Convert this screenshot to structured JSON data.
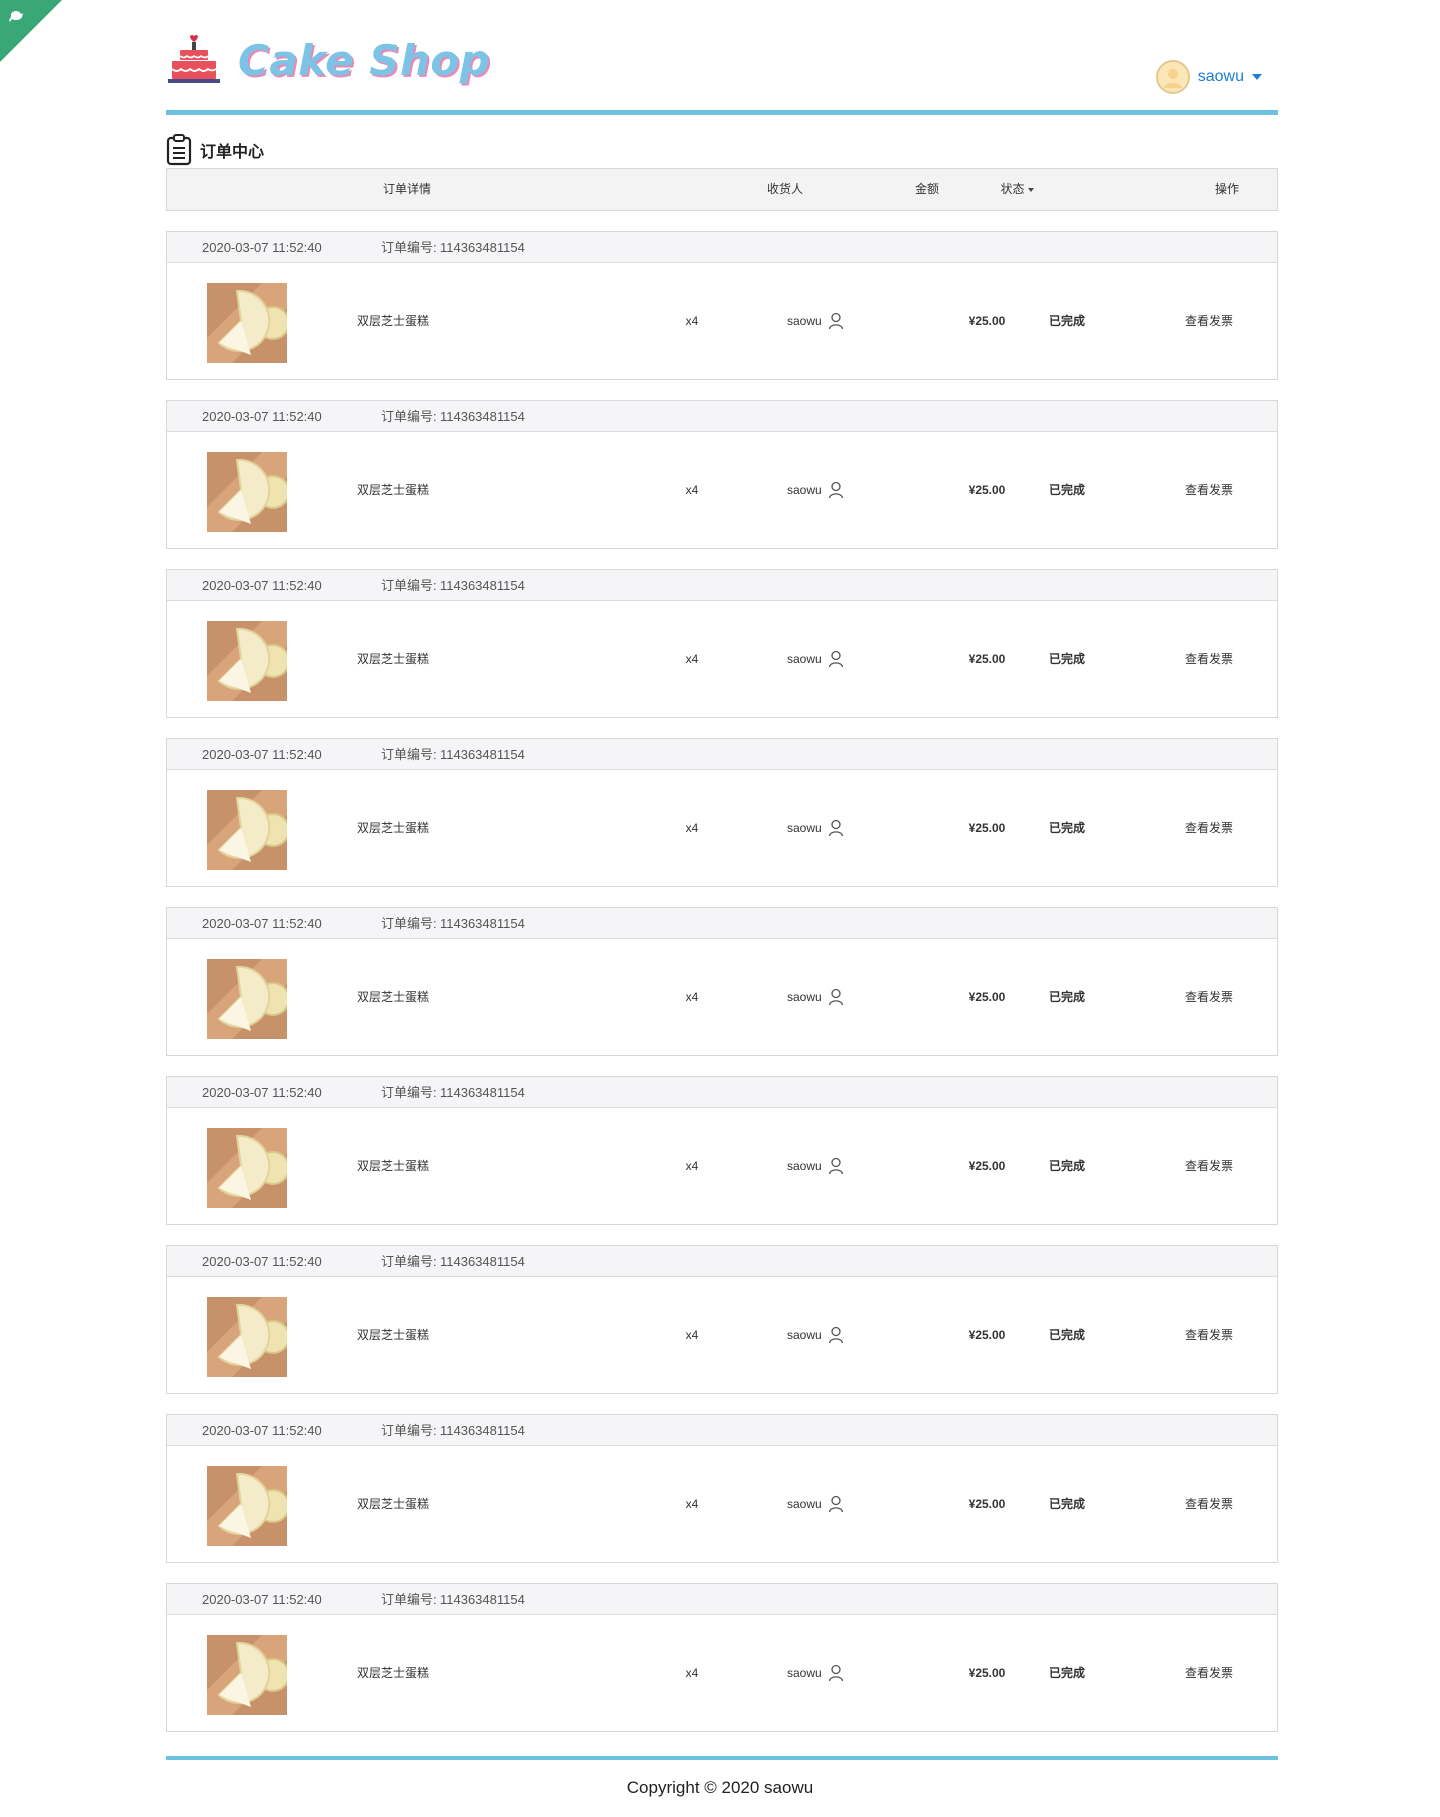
{
  "brand": {
    "name": "Cake Shop"
  },
  "user": {
    "name": "saowu"
  },
  "section": {
    "title": "订单中心"
  },
  "table": {
    "headers": {
      "detail": "订单详情",
      "receiver": "收货人",
      "amount": "金额",
      "status": "状态",
      "ops": "操作"
    },
    "order_no_label": "订单编号:"
  },
  "orders": [
    {
      "time": "2020-03-07 11:52:40",
      "order_no": "114363481154",
      "product": "双层芝士蛋糕",
      "qty": "x4",
      "receiver": "saowu",
      "price": "¥25.00",
      "status": "已完成",
      "action": "查看发票"
    },
    {
      "time": "2020-03-07 11:52:40",
      "order_no": "114363481154",
      "product": "双层芝士蛋糕",
      "qty": "x4",
      "receiver": "saowu",
      "price": "¥25.00",
      "status": "已完成",
      "action": "查看发票"
    },
    {
      "time": "2020-03-07 11:52:40",
      "order_no": "114363481154",
      "product": "双层芝士蛋糕",
      "qty": "x4",
      "receiver": "saowu",
      "price": "¥25.00",
      "status": "已完成",
      "action": "查看发票"
    },
    {
      "time": "2020-03-07 11:52:40",
      "order_no": "114363481154",
      "product": "双层芝士蛋糕",
      "qty": "x4",
      "receiver": "saowu",
      "price": "¥25.00",
      "status": "已完成",
      "action": "查看发票"
    },
    {
      "time": "2020-03-07 11:52:40",
      "order_no": "114363481154",
      "product": "双层芝士蛋糕",
      "qty": "x4",
      "receiver": "saowu",
      "price": "¥25.00",
      "status": "已完成",
      "action": "查看发票"
    },
    {
      "time": "2020-03-07 11:52:40",
      "order_no": "114363481154",
      "product": "双层芝士蛋糕",
      "qty": "x4",
      "receiver": "saowu",
      "price": "¥25.00",
      "status": "已完成",
      "action": "查看发票"
    },
    {
      "time": "2020-03-07 11:52:40",
      "order_no": "114363481154",
      "product": "双层芝士蛋糕",
      "qty": "x4",
      "receiver": "saowu",
      "price": "¥25.00",
      "status": "已完成",
      "action": "查看发票"
    },
    {
      "time": "2020-03-07 11:52:40",
      "order_no": "114363481154",
      "product": "双层芝士蛋糕",
      "qty": "x4",
      "receiver": "saowu",
      "price": "¥25.00",
      "status": "已完成",
      "action": "查看发票"
    },
    {
      "time": "2020-03-07 11:52:40",
      "order_no": "114363481154",
      "product": "双层芝士蛋糕",
      "qty": "x4",
      "receiver": "saowu",
      "price": "¥25.00",
      "status": "已完成",
      "action": "查看发票"
    }
  ],
  "footer": {
    "copyright": "Copyright © 2020 saowu"
  },
  "colors": {
    "accent_bar": "#6cc1de",
    "link_blue": "#1e7dd6",
    "ribbon_green": "#3aa776"
  },
  "icons": {
    "ribbon": "github-corner-icon",
    "logo": "cake-icon",
    "section": "clipboard-icon",
    "receiver": "user-icon"
  }
}
